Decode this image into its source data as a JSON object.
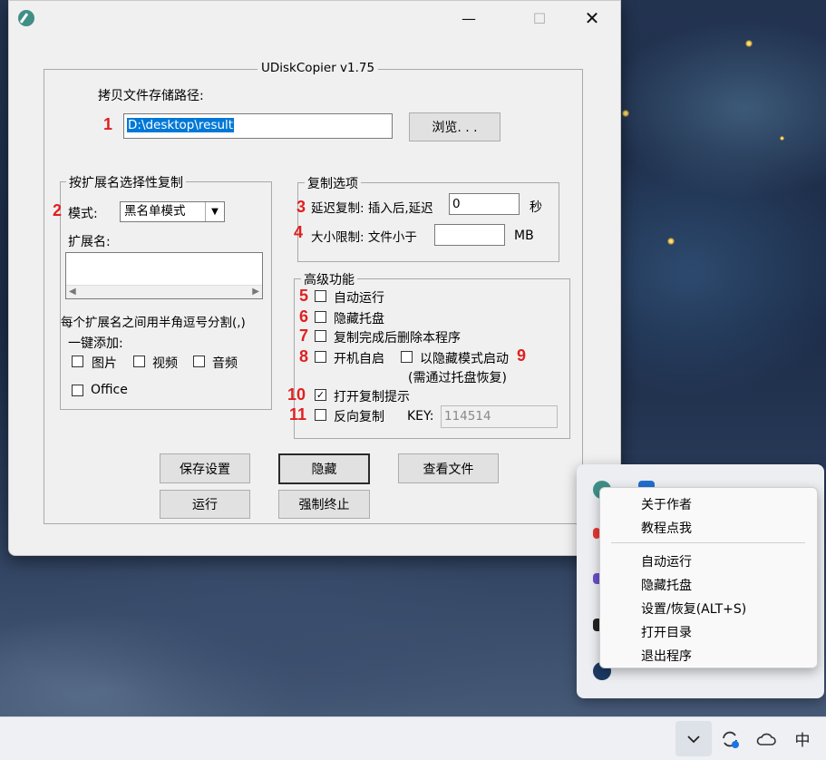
{
  "window": {
    "title": "UDiskCopier v1.75",
    "controls": {
      "minimize": "—",
      "maximize": "☐",
      "close": "✕"
    }
  },
  "path_section": {
    "label": "拷贝文件存储路径:",
    "value": "D:\\desktop\\result",
    "browse_label": "浏览. . ."
  },
  "extension_group": {
    "title": "按扩展名选择性复制",
    "mode_label": "模式:",
    "mode_value": "黑名单模式",
    "ext_label": "扩展名:",
    "hint": "每个扩展名之间用半角逗号分割(,)",
    "quick_add_label": "一键添加:",
    "options": [
      {
        "label": "图片",
        "checked": false
      },
      {
        "label": "视频",
        "checked": false
      },
      {
        "label": "音频",
        "checked": false
      },
      {
        "label": "Office",
        "checked": false
      }
    ]
  },
  "copy_options": {
    "title": "复制选项",
    "delay_label": "延迟复制: 插入后,延迟",
    "delay_value": "0",
    "delay_unit": "秒",
    "size_label": "大小限制:  文件小于",
    "size_value": "",
    "size_unit": "MB"
  },
  "advanced": {
    "title": "高级功能",
    "items": [
      {
        "label": "自动运行",
        "checked": false
      },
      {
        "label": "隐藏托盘",
        "checked": false
      },
      {
        "label": "复制完成后删除本程序",
        "checked": false
      },
      {
        "label": "开机自启",
        "checked": false
      },
      {
        "label": "以隐藏模式启动",
        "checked": false
      },
      {
        "label": "打开复制提示",
        "checked": true
      },
      {
        "label": "反向复制",
        "checked": false
      }
    ],
    "hidden_mode_note": "(需通过托盘恢复)",
    "key_label": "KEY:",
    "key_value": "114514"
  },
  "annotations": [
    "1",
    "2",
    "3",
    "4",
    "5",
    "6",
    "7",
    "8",
    "9",
    "10",
    "11"
  ],
  "buttons": {
    "save": "保存设置",
    "hide": "隐藏",
    "view_files": "查看文件",
    "run": "运行",
    "force_stop": "强制终止"
  },
  "context_menu": {
    "items": [
      "关于作者",
      "教程点我",
      "自动运行",
      "隐藏托盘",
      "设置/恢复(ALT+S)",
      "打开目录",
      "退出程序"
    ]
  },
  "taskbar": {
    "ime": "中",
    "chevron_icon": "chevron-down-icon",
    "sync_icon": "sync-icon",
    "cloud_icon": "cloud-icon"
  },
  "colors": {
    "annotation_red": "#e02020",
    "selection_blue": "#0078d7",
    "window_bg": "#f0f0f0",
    "accent_teal": "#3f8f87"
  }
}
